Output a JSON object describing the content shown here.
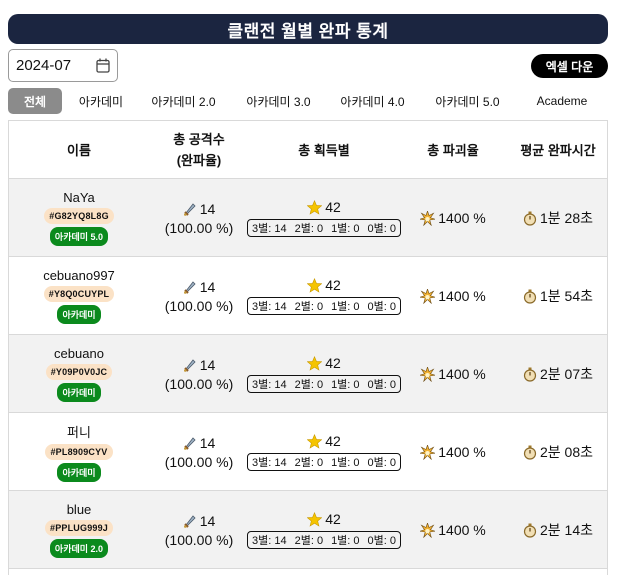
{
  "title": "클랜전 월별 완파 통계",
  "date": {
    "value": "2024-07"
  },
  "excel_label": "엑셀 다운",
  "tabs": [
    {
      "label": "전체",
      "active": true
    },
    {
      "label": "아카데미",
      "active": false
    },
    {
      "label": "아카데미 2.0",
      "active": false
    },
    {
      "label": "아카데미 3.0",
      "active": false
    },
    {
      "label": "아카데미 4.0",
      "active": false
    },
    {
      "label": "아카데미 5.0",
      "active": false
    },
    {
      "label": "Academe",
      "active": false
    }
  ],
  "headers": {
    "name": "이름",
    "attacks_line1": "총 공격수",
    "attacks_line2": "(완파율)",
    "stars": "총 획득별",
    "destruction": "총 파괴율",
    "avg_time": "평균 완파시간"
  },
  "colors": {
    "title_bg": "#1b2540",
    "badge_green": "#0b8a1d",
    "tag_bg": "#fbe2c6",
    "active_tab": "#8b8b8b",
    "star": "#f5c400"
  },
  "icons": {
    "attack": "sword-icon",
    "star": "star-icon",
    "destruction": "explosion-icon",
    "time": "stopwatch-icon",
    "calendar": "calendar-icon"
  },
  "rows": [
    {
      "name": "NaYa",
      "tag": "#G82YQ8L8G",
      "clan": "아카데미 5.0",
      "attacks": "14",
      "rate": "(100.00 %)",
      "stars": "42",
      "s3": "3별: 14",
      "s2": "2별: 0",
      "s1": "1별: 0",
      "s0": "0별: 0",
      "destruction": "1400 %",
      "time": "1분 28초"
    },
    {
      "name": "cebuano997",
      "tag": "#Y8Q0CUYPL",
      "clan": "아카데미",
      "attacks": "14",
      "rate": "(100.00 %)",
      "stars": "42",
      "s3": "3별: 14",
      "s2": "2별: 0",
      "s1": "1별: 0",
      "s0": "0별: 0",
      "destruction": "1400 %",
      "time": "1분 54초"
    },
    {
      "name": "cebuano",
      "tag": "#Y09P0V0JC",
      "clan": "아카데미",
      "attacks": "14",
      "rate": "(100.00 %)",
      "stars": "42",
      "s3": "3별: 14",
      "s2": "2별: 0",
      "s1": "1별: 0",
      "s0": "0별: 0",
      "destruction": "1400 %",
      "time": "2분 07초"
    },
    {
      "name": "퍼니",
      "tag": "#PL8909CYV",
      "clan": "아카데미",
      "attacks": "14",
      "rate": "(100.00 %)",
      "stars": "42",
      "s3": "3별: 14",
      "s2": "2별: 0",
      "s1": "1별: 0",
      "s0": "0별: 0",
      "destruction": "1400 %",
      "time": "2분 08초"
    },
    {
      "name": "blue",
      "tag": "#PPLUG999J",
      "clan": "아카데미 2.0",
      "attacks": "14",
      "rate": "(100.00 %)",
      "stars": "42",
      "s3": "3별: 14",
      "s2": "2별: 0",
      "s1": "1별: 0",
      "s0": "0별: 0",
      "destruction": "1400 %",
      "time": "2분 14초"
    }
  ]
}
